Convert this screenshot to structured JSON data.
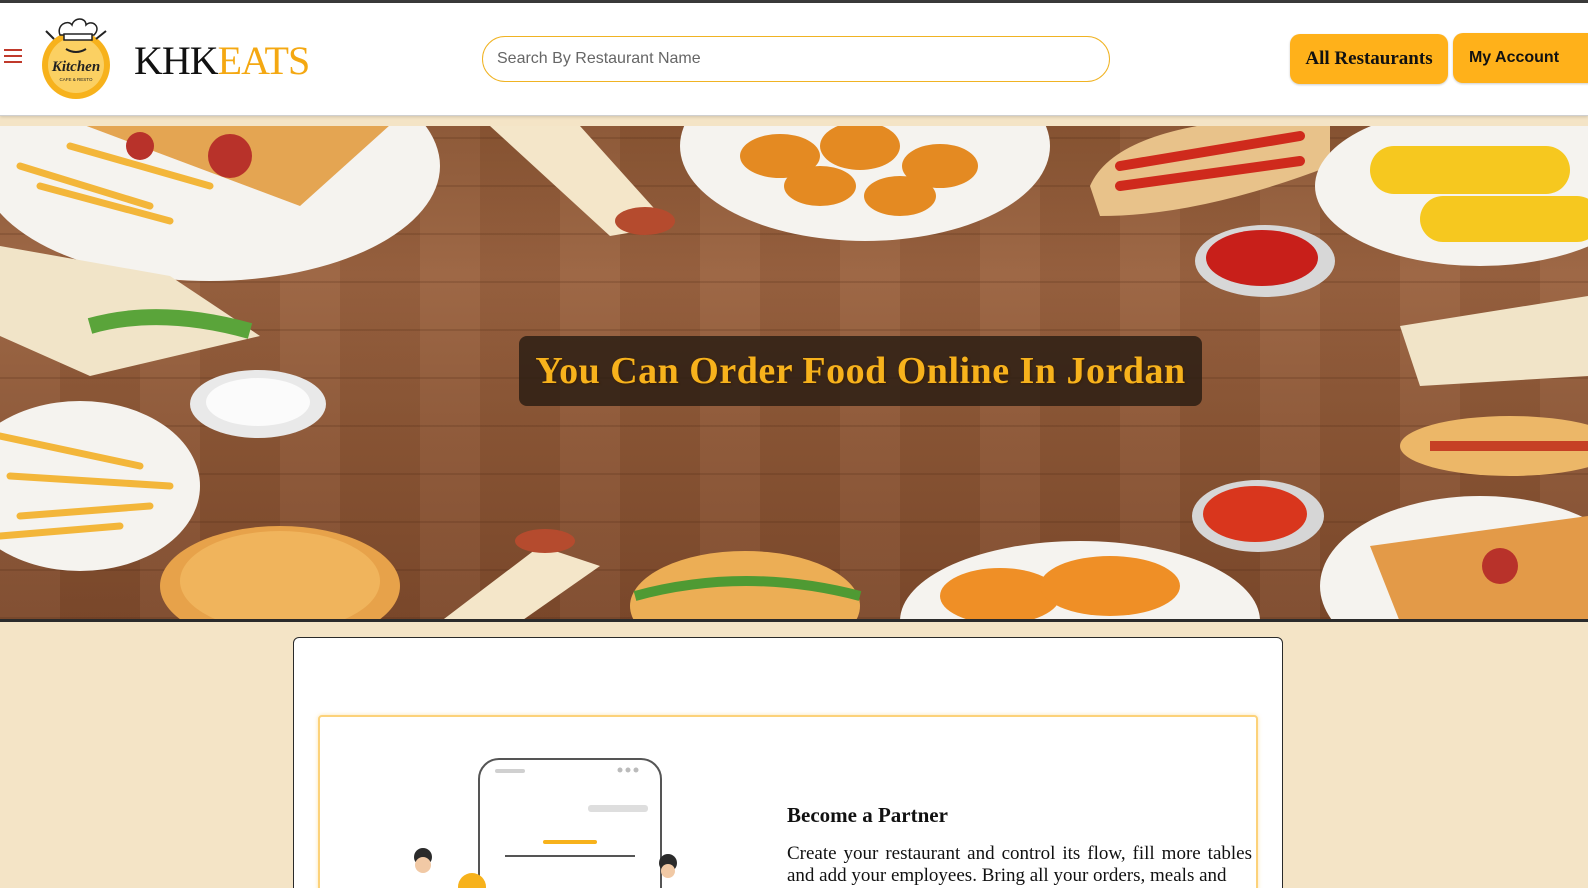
{
  "header": {
    "brand_part1": "KHK",
    "brand_part2": "EATS",
    "logo_text": "Kitchen",
    "logo_subtext": "CAFE & RESTO",
    "search_placeholder": "Search By Restaurant Name",
    "all_restaurants_label": "All Restaurants",
    "my_account_label": "My Account",
    "icons": [
      "hamburger-menu-icon",
      "kitchen-logo"
    ]
  },
  "hero": {
    "headline": "You Can Order Food Online In Jordan"
  },
  "partner": {
    "title": "Become a Partner",
    "text": "Create your restaurant and control its flow, fill more tables and add your employees. Bring all your orders, meals and"
  },
  "colors": {
    "accent": "#ffb11a",
    "brand_orange": "#f4a812",
    "page_background": "#f4e4c6",
    "hero_wood": "#8a5533"
  }
}
